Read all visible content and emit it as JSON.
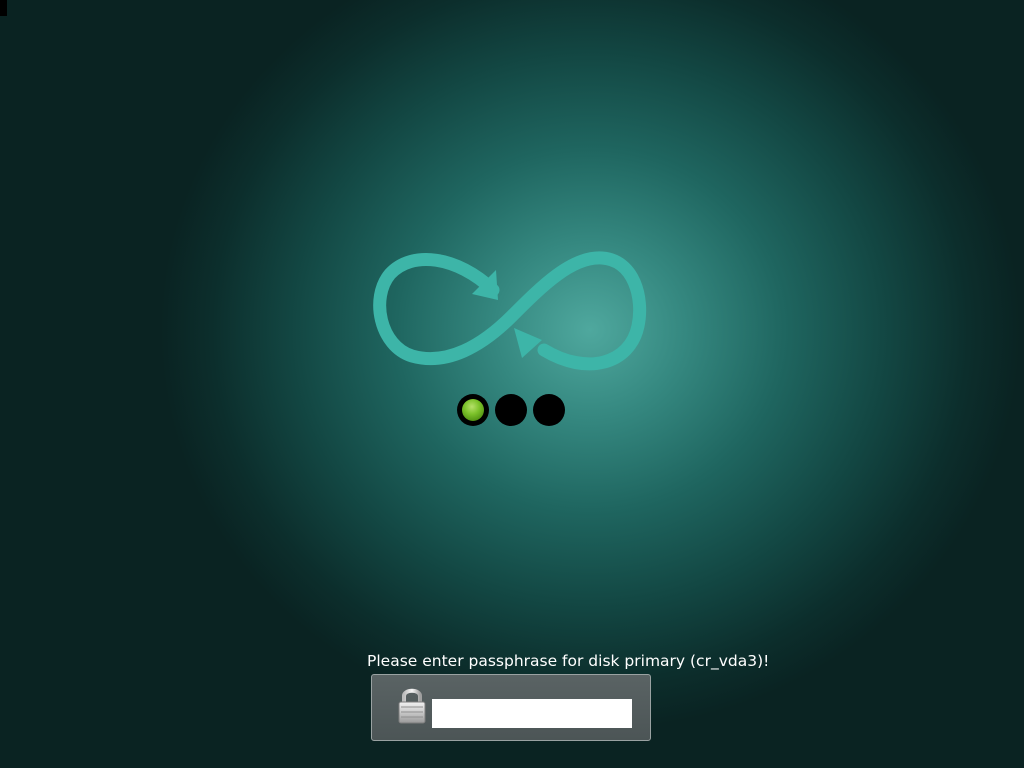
{
  "boot_splash": {
    "logo_icon": "infinity-loop-arrows-icon",
    "progress": {
      "total_steps": 3,
      "current_step": 1,
      "active_color": "#7cc22a",
      "inactive_color": "#000000"
    },
    "accent_color": "#3db5a8"
  },
  "passphrase_prompt": {
    "message": "Please enter passphrase for disk primary (cr_vda3)!",
    "lock_icon": "padlock-icon",
    "input_value": "",
    "input_placeholder": ""
  }
}
